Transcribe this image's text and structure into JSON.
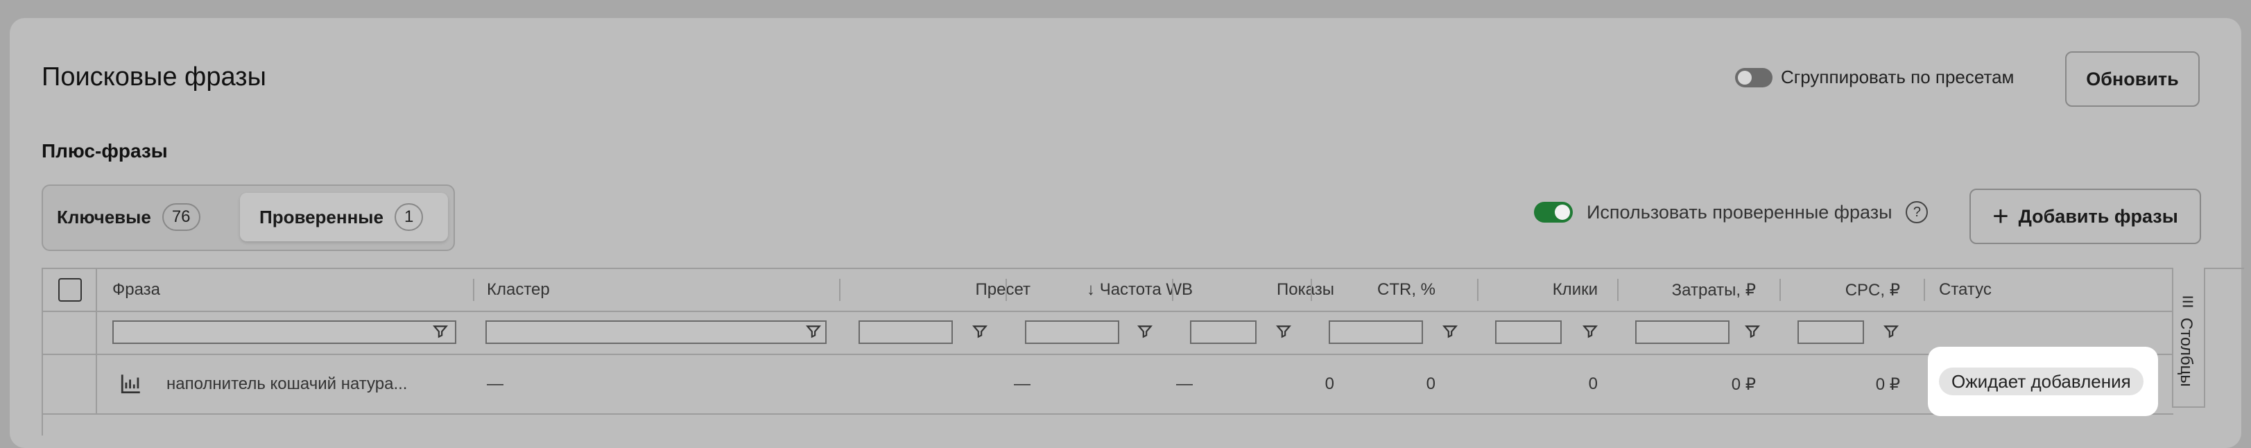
{
  "header": {
    "title": "Поисковые фразы",
    "group_by_presets_label": "Сгруппировать по пресетам",
    "group_by_presets_enabled": false,
    "refresh_label": "Обновить"
  },
  "plus_phrases": {
    "title": "Плюс-фразы",
    "tabs": [
      {
        "label": "Ключевые",
        "count": "76"
      },
      {
        "label": "Проверенные",
        "count": "1"
      }
    ],
    "active_tab": "Проверенные",
    "use_verified_label": "Использовать проверенные фразы",
    "use_verified_enabled": true,
    "help_icon": "?",
    "add_phrases_label": "Добавить фразы",
    "add_icon": "+"
  },
  "table": {
    "columns": [
      "Фраза",
      "Кластер",
      "Пресет",
      "↓ Частота WB",
      "Показы",
      "CTR, %",
      "Клики",
      "Затраты, ₽",
      "CPC, ₽",
      "Статус"
    ],
    "row": {
      "phrase": "наполнитель кошачий натура...",
      "cluster": "—",
      "preset": "—",
      "frequency": "—",
      "impressions": "0",
      "ctr": "0",
      "clicks": "0",
      "cost": "0 ₽",
      "cpc": "0 ₽",
      "status": "Ожидает добавления"
    },
    "columns_panel_label": "Столбцы"
  },
  "colors": {
    "toggle_on": "#1f7a34",
    "background_overlay": "#bdbdbd"
  }
}
